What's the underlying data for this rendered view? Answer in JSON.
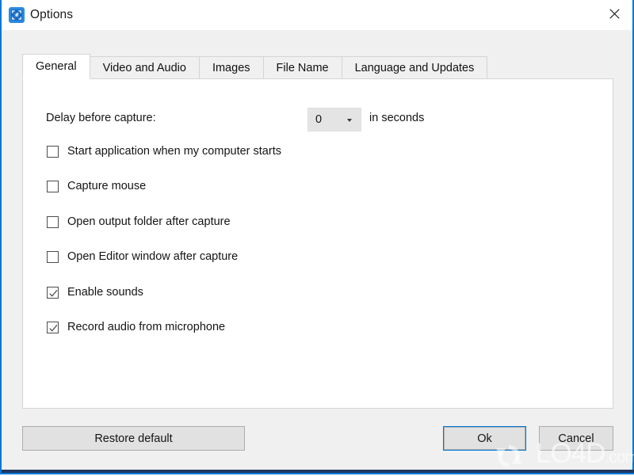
{
  "window": {
    "title": "Options",
    "icon": "capture-app-icon",
    "close_icon": "close-icon",
    "accent_color": "#0078d7",
    "chrome_color": "#f0f0f0",
    "panel_color": "#ffffff"
  },
  "tabs": [
    {
      "label": "General",
      "active": true
    },
    {
      "label": "Video and Audio",
      "active": false
    },
    {
      "label": "Images",
      "active": false
    },
    {
      "label": "File Name",
      "active": false
    },
    {
      "label": "Language and Updates",
      "active": false
    }
  ],
  "general": {
    "delay": {
      "label": "Delay before capture:",
      "value": "0",
      "unit_label": "in seconds",
      "arrow_icon": "chevron-down-icon"
    },
    "checkboxes": [
      {
        "label": "Start application when my computer starts",
        "checked": false
      },
      {
        "label": "Capture mouse",
        "checked": false
      },
      {
        "label": "Open output folder after capture",
        "checked": false
      },
      {
        "label": "Open Editor window after capture",
        "checked": false
      },
      {
        "label": "Enable sounds",
        "checked": true
      },
      {
        "label": "Record audio from microphone",
        "checked": true
      }
    ]
  },
  "footer": {
    "restore_label": "Restore default",
    "ok_label": "Ok",
    "cancel_label": "Cancel"
  },
  "watermark": {
    "text": "LO4D",
    "suffix": ".com",
    "logo_icon": "refresh-circle-icon"
  }
}
